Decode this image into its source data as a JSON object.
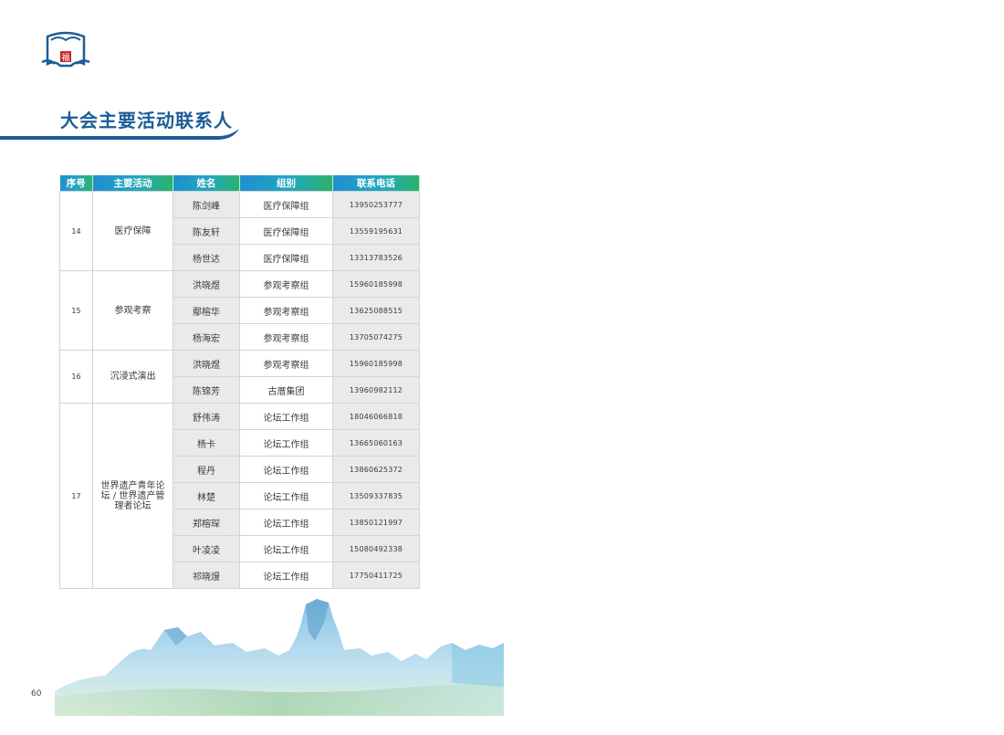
{
  "header": {
    "logo_icon": "fu-emblem-icon",
    "title": "大会主要活动联系人"
  },
  "table": {
    "headers": [
      "序号",
      "主要活动",
      "姓名",
      "组别",
      "联系电话"
    ],
    "groups": [
      {
        "seq": "14",
        "activity": "医疗保障",
        "rows": [
          {
            "name": "陈剑峰",
            "group": "医疗保障组",
            "phone": "13950253777"
          },
          {
            "name": "陈友轩",
            "group": "医疗保障组",
            "phone": "13559195631"
          },
          {
            "name": "杨世达",
            "group": "医疗保障组",
            "phone": "13313783526"
          }
        ]
      },
      {
        "seq": "15",
        "activity": "参观考察",
        "rows": [
          {
            "name": "洪晓煜",
            "group": "参观考察组",
            "phone": "15960185998"
          },
          {
            "name": "鄢榕华",
            "group": "参观考察组",
            "phone": "13625088515"
          },
          {
            "name": "杨海宏",
            "group": "参观考察组",
            "phone": "13705074275"
          }
        ]
      },
      {
        "seq": "16",
        "activity": "沉浸式演出",
        "rows": [
          {
            "name": "洪晓煜",
            "group": "参观考察组",
            "phone": "15960185998"
          },
          {
            "name": "陈锦芳",
            "group": "古厝集团",
            "phone": "13960982112"
          }
        ]
      },
      {
        "seq": "17",
        "activity": "世界遗产青年论坛 / 世界遗产管理者论坛",
        "rows": [
          {
            "name": "舒伟涛",
            "group": "论坛工作组",
            "phone": "18046066818"
          },
          {
            "name": "杨卡",
            "group": "论坛工作组",
            "phone": "13665060163"
          },
          {
            "name": "程丹",
            "group": "论坛工作组",
            "phone": "13860625372"
          },
          {
            "name": "林楚",
            "group": "论坛工作组",
            "phone": "13509337835"
          },
          {
            "name": "郑榕琛",
            "group": "论坛工作组",
            "phone": "13850121997"
          },
          {
            "name": "叶凌凌",
            "group": "论坛工作组",
            "phone": "15080492338"
          },
          {
            "name": "祁晓熳",
            "group": "论坛工作组",
            "phone": "17750411725"
          }
        ]
      }
    ]
  },
  "footer": {
    "page_number": "60"
  },
  "colors": {
    "title": "#1c5d97",
    "header_gradient_start": "#1f8fd2",
    "header_gradient_end": "#2bb36a",
    "shaded_cell": "#e9eaeb"
  }
}
